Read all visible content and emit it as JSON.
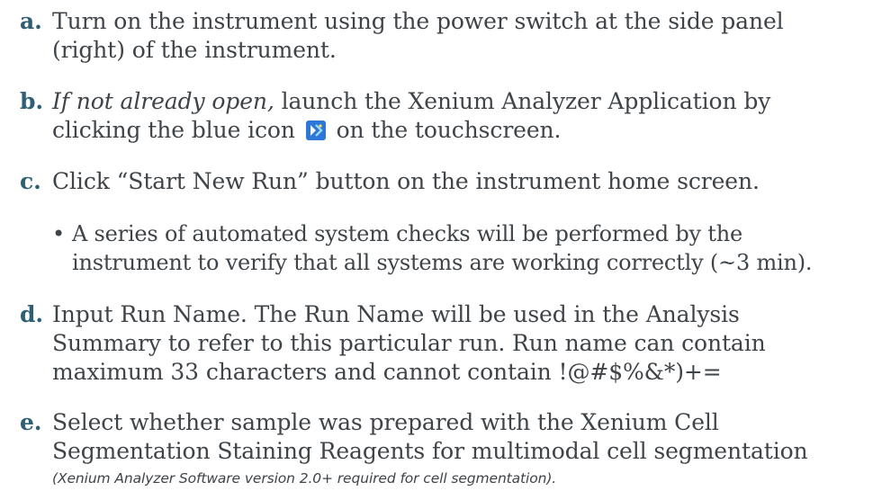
{
  "steps": {
    "a": {
      "letter": "a.",
      "line1": "Turn on the instrument using the power switch at the side panel",
      "line2": "(right) of the instrument."
    },
    "b": {
      "letter": "b.",
      "italic": "If not already open,",
      "line1_rest": " launch the Xenium Analyzer Application by",
      "line2_before_icon": "clicking the blue icon",
      "line2_after_icon": "on the touchscreen.",
      "icon": "xenium-app-icon",
      "icon_color": "#2f76d9"
    },
    "c": {
      "letter": "c.",
      "line1": "Click “Start New Run” button on the instrument home screen."
    },
    "c_bullet": {
      "dot": "•",
      "line1": "A series of automated system checks will be performed by the",
      "line2": "instrument to verify that all systems are working correctly (~3 min)."
    },
    "d": {
      "letter": "d.",
      "line1": "Input Run Name. The Run Name will be used in the Analysis",
      "line2": "Summary to refer to this particular run. Run name can contain",
      "line3": "maximum 33 characters and cannot contain !@#$%&*)+="
    },
    "e": {
      "letter": "e.",
      "line1": "Select whether sample was prepared with the Xenium Cell",
      "line2": "Segmentation Staining Reagents for multimodal cell segmentation",
      "note": "(Xenium Analyzer Software version 2.0+ required for cell segmentation)."
    }
  },
  "colors": {
    "letter": "#2e5f75",
    "text": "#3f4449",
    "icon": "#2f76d9"
  }
}
